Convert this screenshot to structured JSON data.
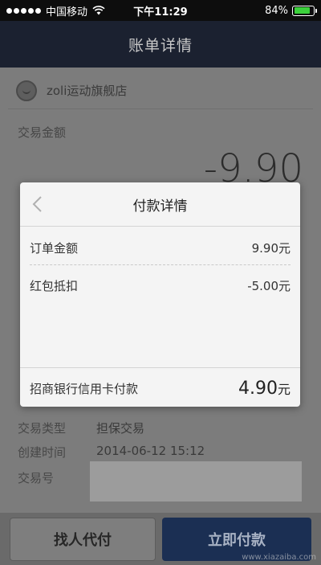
{
  "status_bar": {
    "carrier": "中国移动",
    "time": "下午11:29",
    "battery_percent": "84%",
    "battery_level": 0.84
  },
  "nav": {
    "title": "账单详情"
  },
  "page": {
    "store_name": "zoli运动旗舰店",
    "amount_label": "交易金额",
    "amount_value": "-9.90",
    "info": [
      {
        "label": "交易类型",
        "value": "担保交易"
      },
      {
        "label": "创建时间",
        "value": "2014-06-12 15:12"
      },
      {
        "label": "交易号",
        "value": ""
      }
    ],
    "buttons": {
      "friend_pay": "找人代付",
      "pay_now": "立即付款"
    }
  },
  "modal": {
    "title": "付款详情",
    "rows": [
      {
        "label": "订单金额",
        "value": "9.90元"
      },
      {
        "label": "红包抵扣",
        "value": "-5.00元"
      }
    ],
    "bank_label": "招商银行信用卡付款",
    "bank_amount": "4.90",
    "bank_unit": "元"
  },
  "watermark": "www.xiazaiba.com",
  "colors": {
    "nav_bg": "#1b2130",
    "pay_button": "#1b2f53",
    "battery_fill": "#3bd13b"
  }
}
